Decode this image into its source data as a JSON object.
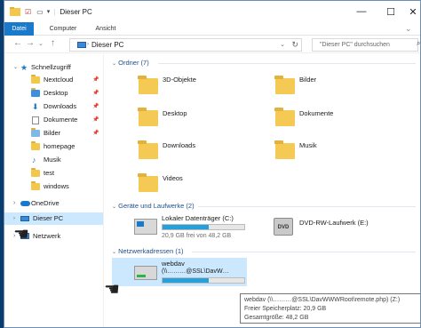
{
  "window": {
    "title": "Dieser PC",
    "controls": [
      "minimize",
      "maximize",
      "close"
    ]
  },
  "ribbon": {
    "tabs": [
      "Datei",
      "Computer",
      "Ansicht"
    ]
  },
  "address_bar": {
    "path": "Dieser PC",
    "search_placeholder": "\"Dieser PC\" durchsuchen"
  },
  "sidebar": {
    "quick_access_label": "Schnellzugriff",
    "quick_items": [
      {
        "label": "Nextcloud",
        "pinned": true
      },
      {
        "label": "Desktop",
        "pinned": true
      },
      {
        "label": "Downloads",
        "pinned": true
      },
      {
        "label": "Dokumente",
        "pinned": true
      },
      {
        "label": "Bilder",
        "pinned": true
      },
      {
        "label": "homepage",
        "pinned": false
      },
      {
        "label": "Musik",
        "pinned": false
      },
      {
        "label": "test",
        "pinned": false
      },
      {
        "label": "windows",
        "pinned": false
      }
    ],
    "onedrive_label": "OneDrive",
    "this_pc_label": "Dieser PC",
    "network_label": "Netzwerk"
  },
  "content": {
    "folders_header": "Ordner (7)",
    "folders": [
      "3D-Objekte",
      "Bilder",
      "Desktop",
      "Dokumente",
      "Downloads",
      "Musik",
      "Videos"
    ],
    "drives_header": "Geräte und Laufwerke (2)",
    "drives": [
      {
        "name": "Lokaler Datenträger (C:)",
        "free_text": "20,9 GB frei von 48,2 GB",
        "used_fraction": 0.57
      },
      {
        "name": "DVD-RW-Laufwerk (E:)"
      }
    ],
    "network_header": "Netzwerkadressen (1)",
    "network_locations": [
      {
        "name": "webdav",
        "path": "(\\\\………@SSL\\DavW…",
        "free_text": "",
        "used_fraction": 0.57
      }
    ]
  },
  "tooltip": {
    "line1": "webdav (\\\\………@SSL\\DavWWWRoot\\remote.php) (Z:)",
    "line2": "Freier Speicherplatz: 20,9 GB",
    "line3": "Gesamtgröße: 48,2 GB"
  },
  "colors": {
    "accent": "#1979ca",
    "bar_fill": "#26a0da",
    "selected_bg": "#cce8ff",
    "folder": "#f4ca55"
  }
}
